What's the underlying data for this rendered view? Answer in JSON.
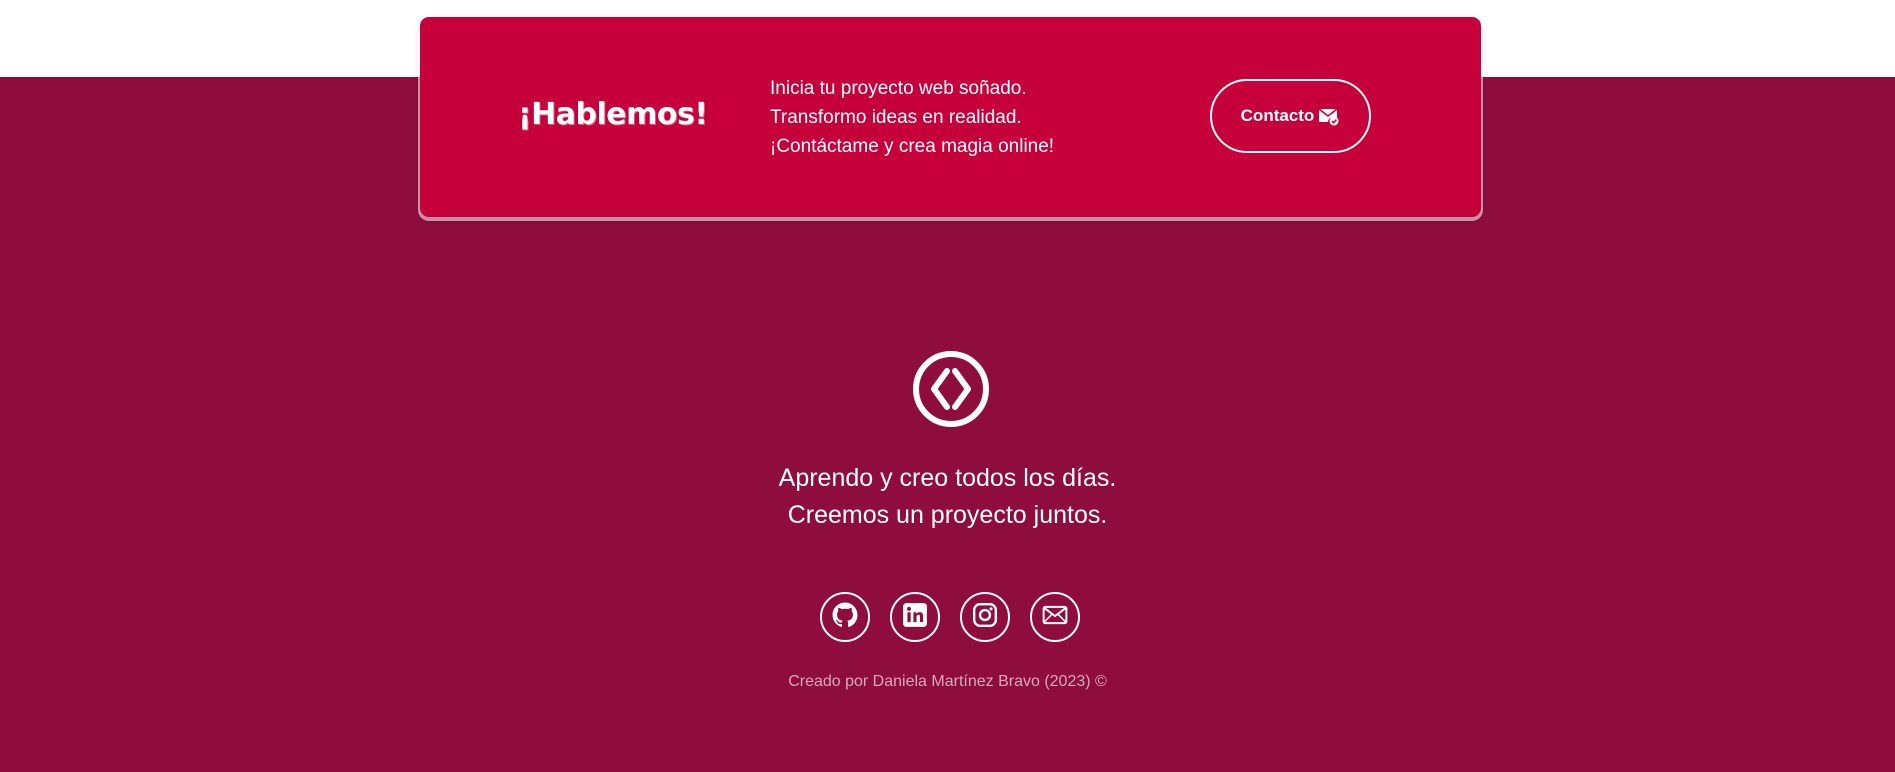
{
  "cta": {
    "title": "¡Hablemos!",
    "lines": [
      "Inicia tu proyecto web soñado.",
      "Transformo ideas en realidad.",
      "¡Contáctame y crea magia online!"
    ],
    "button_label": "Contacto",
    "button_icon": "mail-check-icon"
  },
  "footer": {
    "logo_icon": "code-brackets-icon",
    "tagline_lines": [
      "Aprendo y creo todos los días.",
      "Creemos un proyecto juntos."
    ],
    "socials": [
      {
        "name": "github",
        "icon": "github-icon"
      },
      {
        "name": "linkedin",
        "icon": "linkedin-icon"
      },
      {
        "name": "instagram",
        "icon": "instagram-icon"
      },
      {
        "name": "email",
        "icon": "envelope-icon"
      }
    ],
    "credit": "Creado por Daniela Martínez Bravo (2023) ©"
  },
  "colors": {
    "card_bg": "#c6003b",
    "footer_bg": "#8f0d3c",
    "text": "#ffffff",
    "credit_text": "#d7a9b8"
  }
}
